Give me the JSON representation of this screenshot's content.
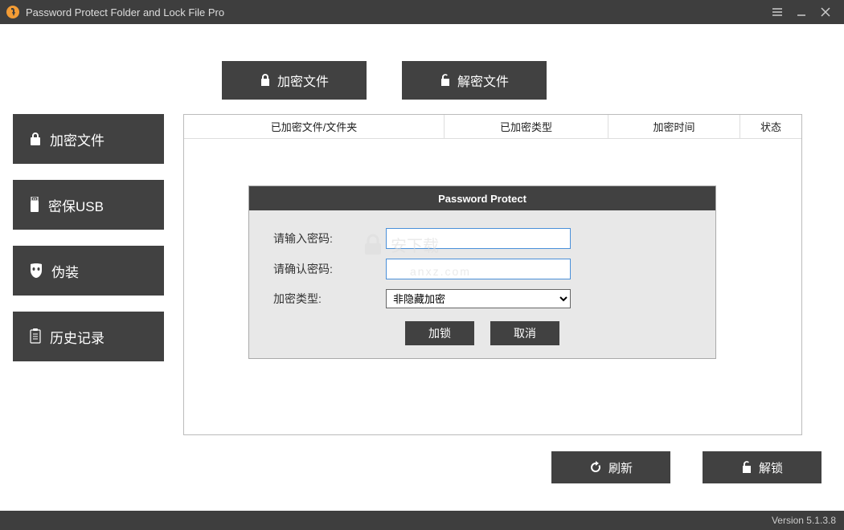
{
  "window": {
    "title": "Password Protect Folder and Lock File Pro"
  },
  "topActions": {
    "encrypt": "加密文件",
    "decrypt": "解密文件"
  },
  "sidebar": {
    "items": [
      {
        "label": "加密文件",
        "icon": "lock-icon"
      },
      {
        "label": "密保USB",
        "icon": "usb-icon"
      },
      {
        "label": "伪装",
        "icon": "mask-icon"
      },
      {
        "label": "历史记录",
        "icon": "clipboard-icon"
      }
    ]
  },
  "table": {
    "headers": [
      "已加密文件/文件夹",
      "已加密类型",
      "加密时间",
      "状态"
    ]
  },
  "dialog": {
    "title": "Password Protect",
    "passwordLabel": "请输入密码:",
    "confirmLabel": "请确认密码:",
    "typeLabel": "加密类型:",
    "typeSelected": "非隐藏加密",
    "lockBtn": "加锁",
    "cancelBtn": "取消"
  },
  "bottom": {
    "refresh": "刷新",
    "unlock": "解锁"
  },
  "status": {
    "version": "Version 5.1.3.8"
  },
  "watermark": {
    "text": "安下载",
    "sub": "anxz.com"
  }
}
